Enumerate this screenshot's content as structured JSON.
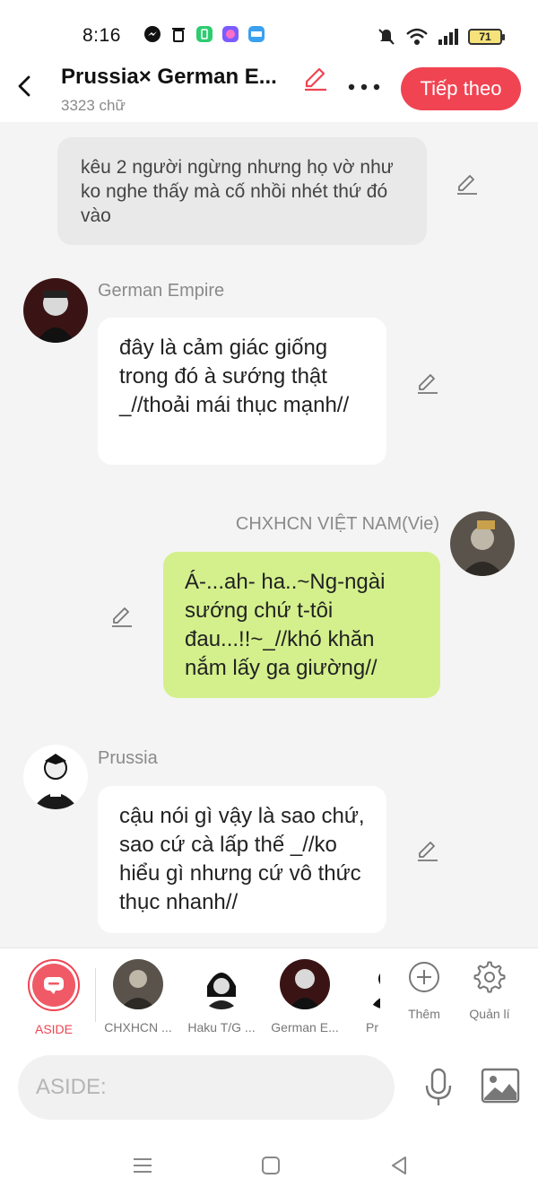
{
  "status_bar": {
    "time": "8:16",
    "battery": "71",
    "notification_icons": [
      "messenger-icon",
      "trash-icon",
      "battery-saver-icon",
      "app-icon",
      "noveltoon-icon"
    ],
    "right_icons": [
      "mute-icon",
      "wifi-icon",
      "signal-icon"
    ]
  },
  "header": {
    "title": "Prussia× German E...",
    "word_count": "3323 chữ",
    "next_label": "Tiếp theo"
  },
  "messages": [
    {
      "type": "aside",
      "text": "kêu 2 người ngừng nhưng họ vờ như ko nghe thấy mà cố nhồi nhét thứ đó vào"
    },
    {
      "type": "left",
      "name": "German Empire",
      "text": "đây là cảm giác giống trong đó à sướng thật _//thoải mái thục mạnh//"
    },
    {
      "type": "right",
      "name": "CHXHCN VIỆT NAM(Vie)",
      "text": "Á-...ah- ha..~Ng-ngài sướng chứ t-tôi đau...!!~_//khó khăn nắm lấy ga giường//"
    },
    {
      "type": "left",
      "name": "Prussia",
      "text": "cậu nói gì vậy là sao chứ, sao cứ cà lấp thế _//ko hiểu gì nhưng cứ vô thức thục nhanh//"
    }
  ],
  "characters": [
    {
      "label": "ASIDE"
    },
    {
      "label": "CHXHCN ..."
    },
    {
      "label": "Haku T/G ..."
    },
    {
      "label": "German E..."
    },
    {
      "label": "Pr"
    }
  ],
  "tools": {
    "add_label": "Thêm",
    "manage_label": "Quản lí"
  },
  "composer": {
    "placeholder": "ASIDE:"
  },
  "colors": {
    "accent": "#f04452",
    "bubble_self": "#d4f08c",
    "bubble_other": "#ffffff",
    "aside_bubble": "#e9e9e9"
  }
}
